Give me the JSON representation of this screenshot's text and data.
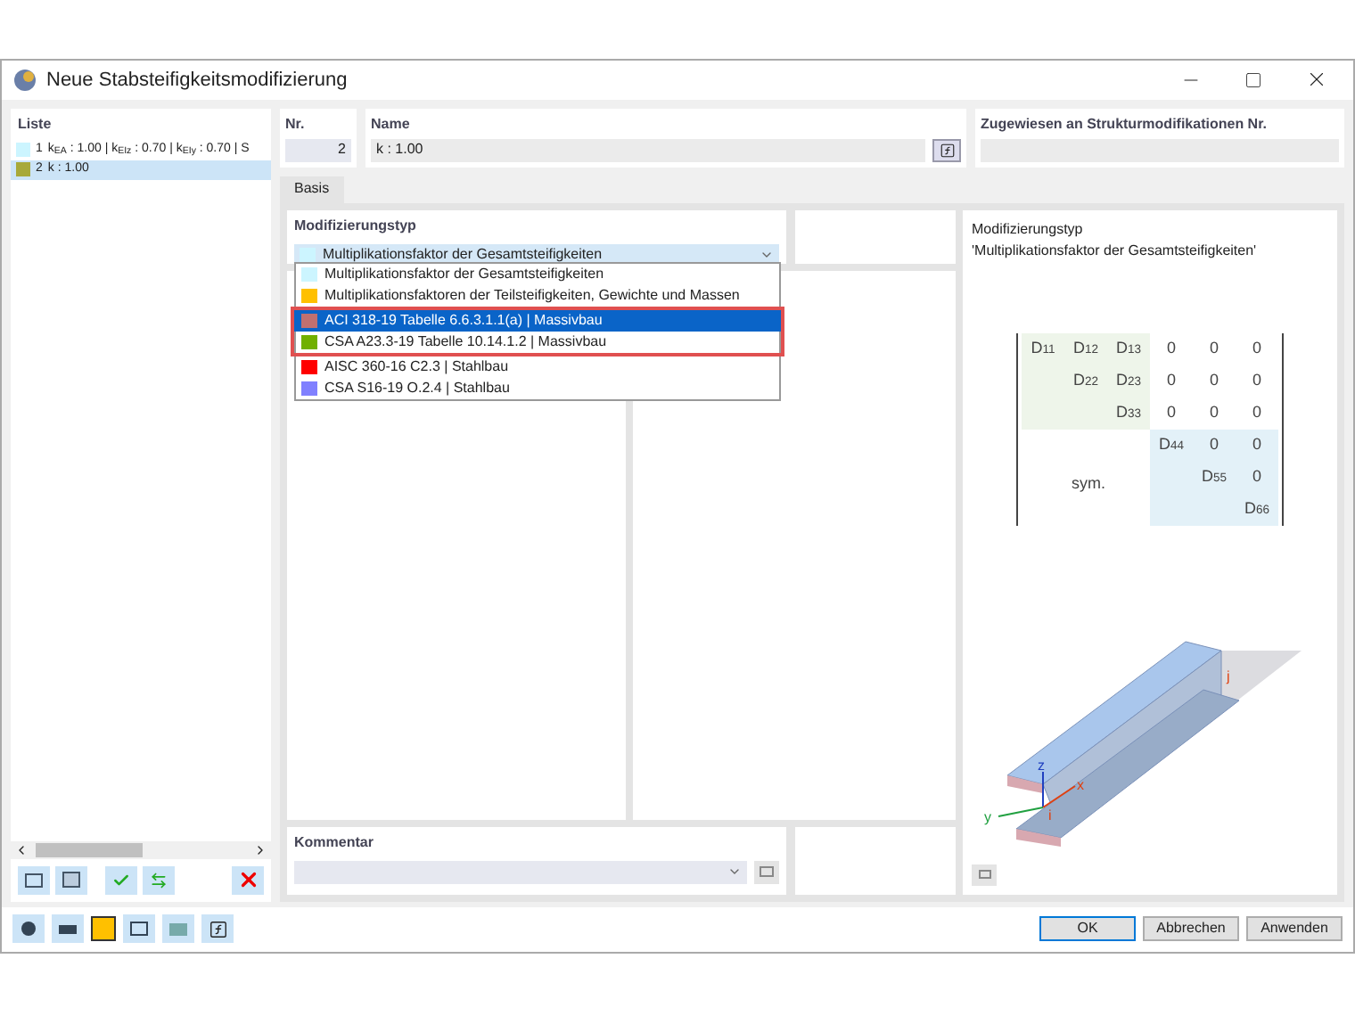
{
  "window": {
    "title": "Neue Stabsteifigkeitsmodifizierung"
  },
  "list": {
    "header": "Liste",
    "items": [
      {
        "number": "1",
        "label": "k$_{EA}$ : 1.00 | k$_{EIz}$ : 0.70 | k$_{EIy}$ : 0.70 | S",
        "color": "#ccf5ff",
        "selected": false
      },
      {
        "number": "2",
        "label": "k : 1.00",
        "color": "#a8a93a",
        "selected": true
      }
    ]
  },
  "nr": {
    "label": "Nr.",
    "value": "2"
  },
  "name": {
    "label": "Name",
    "value": "k : 1.00"
  },
  "assigned": {
    "label": "Zugewiesen an Strukturmodifikationen Nr."
  },
  "tabs": [
    {
      "label": "Basis",
      "selected": true
    }
  ],
  "modification_type": {
    "label": "Modifizierungstyp",
    "value": {
      "text": "Multiplikationsfaktor der Gesamtsteifigkeiten",
      "color": "#ccf5ff"
    },
    "expanded": true,
    "options": [
      {
        "label": "Multiplikationsfaktor der Gesamtsteifigkeiten",
        "color": "#ccf5ff",
        "selected": false,
        "highlighted": false
      },
      {
        "label": "Multiplikationsfaktoren der Teilsteifigkeiten, Gewichte und Massen",
        "color": "#ffc000",
        "selected": false,
        "highlighted": false
      },
      {
        "label": "ACI 318-19 Tabelle 6.6.3.1.1(a) | Massivbau",
        "color": "#c07070",
        "selected": true,
        "highlighted": true
      },
      {
        "label": "CSA A23.3-19 Tabelle 10.14.1.2 | Massivbau",
        "color": "#70b000",
        "selected": false,
        "highlighted": true
      },
      {
        "label": "AISC 360-16 C2.3 | Stahlbau",
        "color": "#ff0000",
        "selected": false,
        "highlighted": false
      },
      {
        "label": "CSA S16-19 O.2.4 | Stahlbau",
        "color": "#8080ff",
        "selected": false,
        "highlighted": false
      }
    ]
  },
  "comment": {
    "label": "Kommentar"
  },
  "preview": {
    "heading": "Modifizierungstyp",
    "subheading": "'Multiplikationsfaktor der Gesamtsteifigkeiten'",
    "matrix_rows": [
      [
        "D$_{11}$",
        "D$_{12}$",
        "D$_{13}$",
        "0",
        "0",
        "0"
      ],
      [
        "D$_{22}$",
        "D$_{23}$",
        "0",
        "0",
        "0"
      ],
      [
        "D$_{33}$",
        "0",
        "0",
        "0"
      ],
      [
        "D$_{44}$",
        "0",
        "0"
      ],
      [
        "D$_{55}$",
        "0"
      ],
      [
        "D$_{66}$"
      ]
    ],
    "symmetry_label": "sym.",
    "axis_labels": {
      "z": "z",
      "x": "x",
      "y": "y",
      "i": "i",
      "j": "j"
    }
  },
  "buttons": [
    {
      "label": "OK",
      "default": true
    },
    {
      "label": "Abbrechen",
      "default": false
    },
    {
      "label": "Anwenden",
      "default": false
    }
  ]
}
